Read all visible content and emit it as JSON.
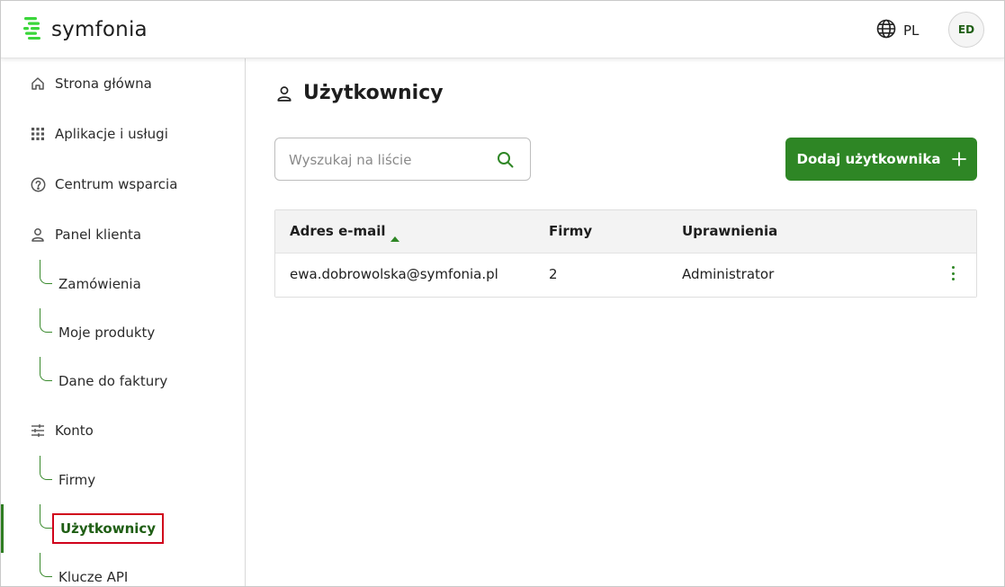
{
  "header": {
    "logo_text": "symfonia",
    "language": "PL",
    "avatar_initials": "ED"
  },
  "sidebar": {
    "items": [
      {
        "label": "Strona główna",
        "icon": "home-icon"
      },
      {
        "label": "Aplikacje i usługi",
        "icon": "grid-icon"
      },
      {
        "label": "Centrum wsparcia",
        "icon": "help-circle-icon"
      },
      {
        "label": "Panel klienta",
        "icon": "user-icon"
      },
      {
        "label": "Konto",
        "icon": "sliders-icon"
      }
    ],
    "panel_sub": [
      "Zamówienia",
      "Moje produkty",
      "Dane do faktury"
    ],
    "konto_sub": [
      "Firmy",
      "Użytkownicy",
      "Klucze API"
    ]
  },
  "main": {
    "title": "Użytkownicy",
    "search_placeholder": "Wyszukaj na liście",
    "add_button_label": "Dodaj użytkownika",
    "table": {
      "columns": [
        "Adres e-mail",
        "Firmy",
        "Uprawnienia"
      ],
      "sort_column": "Adres e-mail",
      "sort_direction": "ascending",
      "rows": [
        {
          "email": "ewa.dobrowolska@symfonia.pl",
          "firms": "2",
          "role": "Administrator"
        }
      ]
    }
  },
  "colors": {
    "brand_green": "#2e8625",
    "logo_green": "#3bd63b",
    "highlight_red": "#d0021b",
    "active_text": "#1f5e14"
  }
}
